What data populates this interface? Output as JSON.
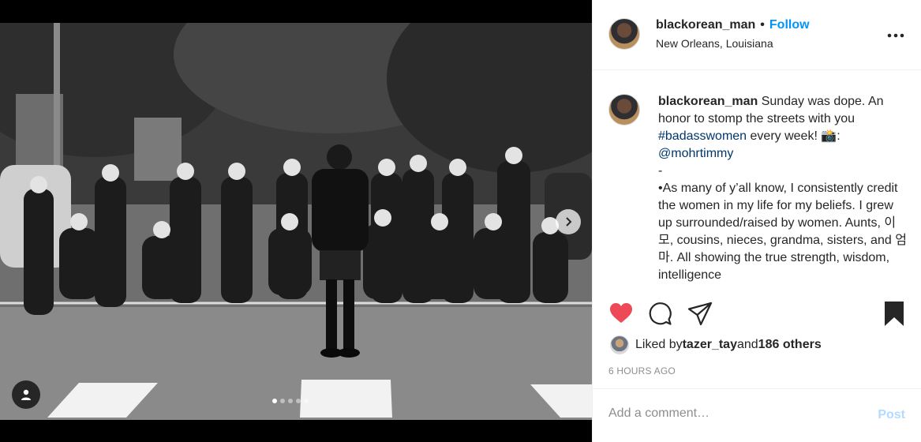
{
  "post": {
    "username": "blackorean_man",
    "separator": "•",
    "follow_label": "Follow",
    "location": "New Orleans, Louisiana",
    "more_icon": "more-horizontal-icon",
    "carousel": {
      "total_slides": 5,
      "active_slide": 1
    }
  },
  "caption": {
    "username": "blackorean_man",
    "text_1": " Sunday was dope. An honor to stomp the streets with you ",
    "hashtag": "#badasswomen",
    "text_2": " every week! 📸: ",
    "mention": "@mohrtimmy",
    "dash": "-",
    "body": "•As many of y’all know, I consistently credit the women in my life for my beliefs. I grew up surrounded/raised by women. Aunts, 이모, cousins, nieces, grandma, sisters, and 엄마. All showing the true strength, wisdom, intelligence"
  },
  "actions": {
    "like_icon": "heart-filled-icon",
    "comment_icon": "comment-icon",
    "share_icon": "share-icon",
    "save_icon": "bookmark-filled-icon",
    "like_color": "#ed4956"
  },
  "likes": {
    "prefix": "Liked by ",
    "user": "tazer_tay",
    "middle": " and ",
    "others": "186 others"
  },
  "timestamp": "6 HOURS AGO",
  "comment": {
    "placeholder": "Add a comment…",
    "post_label": "Post"
  }
}
